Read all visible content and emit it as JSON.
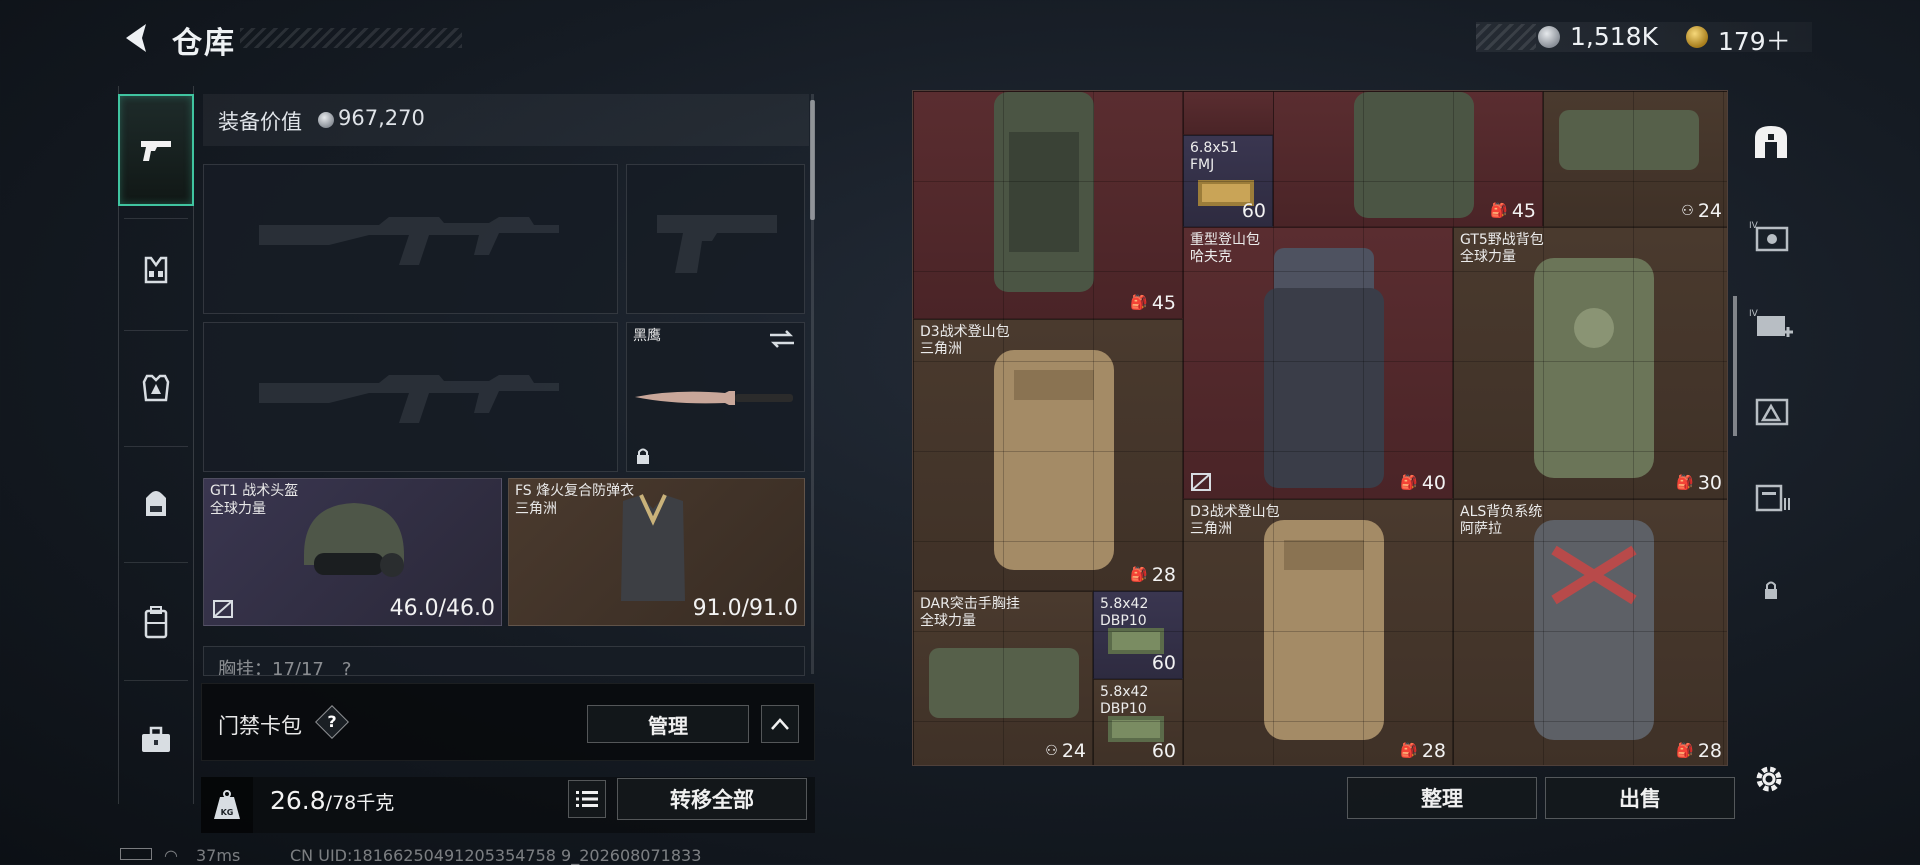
{
  "header": {
    "title": "仓库",
    "currencies": [
      {
        "icon": "silver-coin-icon",
        "value": "1,518K"
      },
      {
        "icon": "gold-coin-icon",
        "value": "179＋"
      }
    ]
  },
  "sidebar": {
    "items": [
      {
        "name": "weapon",
        "icon": "pistol-icon",
        "active": true
      },
      {
        "name": "chest-rig",
        "icon": "chest-rig-icon"
      },
      {
        "name": "armor",
        "icon": "armor-icon"
      },
      {
        "name": "backpack",
        "icon": "backpack-icon"
      },
      {
        "name": "safe-box",
        "icon": "container-icon"
      },
      {
        "name": "toolbox",
        "icon": "toolbox-icon"
      }
    ]
  },
  "equipment": {
    "value_label": "装备价值",
    "value": "967,270",
    "knife": {
      "name": "黑鹰"
    },
    "helmet": {
      "name": "GT1 战术头盔",
      "origin": "全球力量",
      "durability": "46.0/46.0"
    },
    "vest": {
      "name": "FS 烽火复合防弹衣",
      "origin": "三角洲",
      "durability": "91.0/91.0"
    },
    "chest_rig_peek": "胸挂：17/17　?"
  },
  "keybag": {
    "label": "门禁卡包",
    "help": "?",
    "manage_label": "管理"
  },
  "weight": {
    "current": "26.8",
    "max": "/78千克",
    "kg_label": "KG",
    "transfer_label": "转移全部"
  },
  "stash": {
    "items": [
      {
        "name": "",
        "count": "45",
        "count_icon": "backpack-icon"
      },
      {
        "name": "6.8x51\nFMJ",
        "count": "60"
      },
      {
        "name": "",
        "count": "45",
        "count_icon": "backpack-icon"
      },
      {
        "name": "",
        "count": "24",
        "count_icon": "chest-rig-icon"
      },
      {
        "name": "重型登山包\n哈夫克",
        "count": "40",
        "count_icon": "backpack-icon"
      },
      {
        "name": "GT5野战背包\n全球力量",
        "count": "30",
        "count_icon": "backpack-icon"
      },
      {
        "name": "D3战术登山包\n三角洲",
        "count": "28",
        "count_icon": "backpack-icon"
      },
      {
        "name": "D3战术登山包\n三角洲",
        "count": "28",
        "count_icon": "backpack-icon"
      },
      {
        "name": "ALS背负系统\n阿萨拉",
        "count": "28",
        "count_icon": "backpack-icon"
      },
      {
        "name": "DAR突击手胸挂\n全球力量",
        "count": "24",
        "count_icon": "chest-rig-icon"
      },
      {
        "name": "5.8x42\nDBP10",
        "count": "60"
      },
      {
        "name": "5.8x42\nDBP10",
        "count": "60"
      }
    ],
    "sort_label": "整理",
    "sell_label": "出售"
  },
  "right_sidebar": [
    {
      "icon": "stash-home-icon"
    },
    {
      "icon": "expand-stash-icon",
      "badge": "IV"
    },
    {
      "icon": "add-stash-icon",
      "badge": "IV"
    },
    {
      "icon": "stash-page-icon"
    },
    {
      "icon": "stash-list-icon"
    },
    {
      "icon": "lock-icon"
    },
    {
      "icon": "settings-icon"
    }
  ],
  "status": {
    "ping": "37ms",
    "uid": "CN UID:18166250491205354758 9_202608071833"
  },
  "colors": {
    "accent": "#40c4a0",
    "cell_red": "#5a2d30",
    "cell_brown": "#4a3a2e",
    "cell_purple": "#3a3650"
  }
}
